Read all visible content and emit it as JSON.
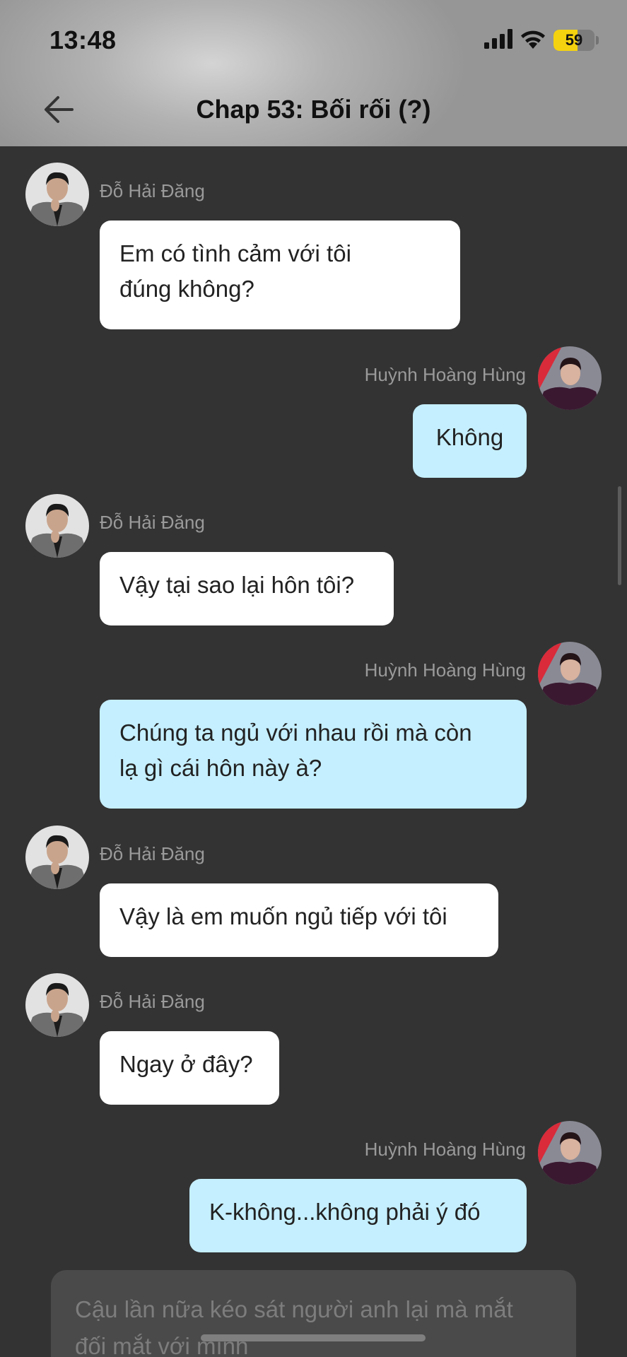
{
  "status_bar": {
    "time": "13:48",
    "battery_percent": "59",
    "battery_level": 0.59,
    "signal_icon": "cellular-signal-icon",
    "wifi_icon": "wifi-icon"
  },
  "header": {
    "title": "Chap 53: Bối rối (?)",
    "back_icon": "arrow-left-icon"
  },
  "messages": [
    {
      "sender": "Đỗ Hải Đăng",
      "side": "left",
      "lines": [
        "Em có tình cảm với tôi",
        "đúng không?"
      ]
    },
    {
      "sender": "Huỳnh Hoàng Hùng",
      "side": "right",
      "lines": [
        "Không"
      ]
    },
    {
      "sender": "Đỗ Hải Đăng",
      "side": "left",
      "lines": [
        "Vậy tại sao lại hôn tôi?"
      ]
    },
    {
      "sender": "Huỳnh Hoàng Hùng",
      "side": "right",
      "lines": [
        "Chúng ta ngủ với nhau rồi mà còn",
        "lạ gì cái hôn này à?"
      ]
    },
    {
      "sender": "Đỗ Hải Đăng",
      "side": "left",
      "lines": [
        "Vậy là em muốn ngủ tiếp với tôi"
      ]
    },
    {
      "sender": "Đỗ Hải Đăng",
      "side": "left",
      "lines": [
        "Ngay ở đây?"
      ]
    },
    {
      "sender": "Huỳnh Hoàng Hùng",
      "side": "right",
      "lines": [
        "K-không...không phải ý đó"
      ]
    }
  ],
  "narration": {
    "lines": [
      "Cậu lần nữa kéo sát người anh lại mà mắt",
      "đối mắt với mình"
    ]
  },
  "colors": {
    "background": "#333333",
    "incoming_bubble": "#ffffff",
    "outgoing_bubble": "#c5efff",
    "sender_name": "#9a9a9a",
    "battery": "#f5d20f"
  }
}
